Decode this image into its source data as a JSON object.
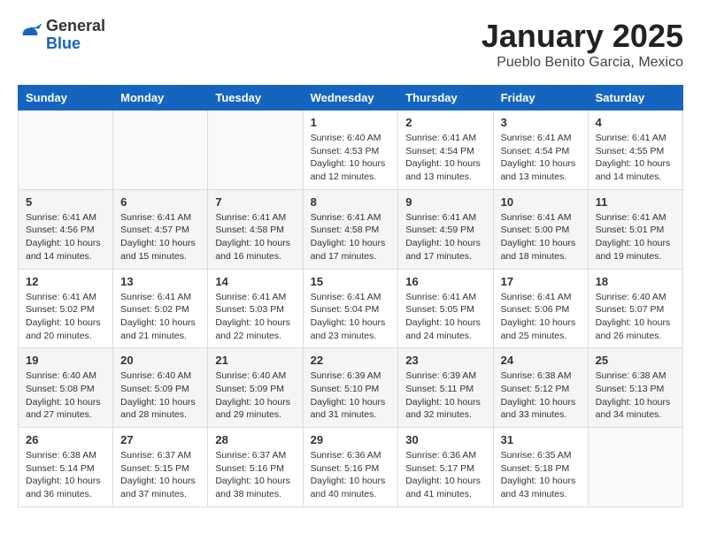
{
  "header": {
    "logo": {
      "general": "General",
      "blue": "Blue"
    },
    "title": "January 2025",
    "location": "Pueblo Benito Garcia, Mexico"
  },
  "calendar": {
    "weekdays": [
      "Sunday",
      "Monday",
      "Tuesday",
      "Wednesday",
      "Thursday",
      "Friday",
      "Saturday"
    ],
    "weeks": [
      [
        {
          "day": "",
          "sunrise": "",
          "sunset": "",
          "daylight": ""
        },
        {
          "day": "",
          "sunrise": "",
          "sunset": "",
          "daylight": ""
        },
        {
          "day": "",
          "sunrise": "",
          "sunset": "",
          "daylight": ""
        },
        {
          "day": "1",
          "sunrise": "Sunrise: 6:40 AM",
          "sunset": "Sunset: 4:53 PM",
          "daylight": "Daylight: 10 hours and 12 minutes."
        },
        {
          "day": "2",
          "sunrise": "Sunrise: 6:41 AM",
          "sunset": "Sunset: 4:54 PM",
          "daylight": "Daylight: 10 hours and 13 minutes."
        },
        {
          "day": "3",
          "sunrise": "Sunrise: 6:41 AM",
          "sunset": "Sunset: 4:54 PM",
          "daylight": "Daylight: 10 hours and 13 minutes."
        },
        {
          "day": "4",
          "sunrise": "Sunrise: 6:41 AM",
          "sunset": "Sunset: 4:55 PM",
          "daylight": "Daylight: 10 hours and 14 minutes."
        }
      ],
      [
        {
          "day": "5",
          "sunrise": "Sunrise: 6:41 AM",
          "sunset": "Sunset: 4:56 PM",
          "daylight": "Daylight: 10 hours and 14 minutes."
        },
        {
          "day": "6",
          "sunrise": "Sunrise: 6:41 AM",
          "sunset": "Sunset: 4:57 PM",
          "daylight": "Daylight: 10 hours and 15 minutes."
        },
        {
          "day": "7",
          "sunrise": "Sunrise: 6:41 AM",
          "sunset": "Sunset: 4:58 PM",
          "daylight": "Daylight: 10 hours and 16 minutes."
        },
        {
          "day": "8",
          "sunrise": "Sunrise: 6:41 AM",
          "sunset": "Sunset: 4:58 PM",
          "daylight": "Daylight: 10 hours and 17 minutes."
        },
        {
          "day": "9",
          "sunrise": "Sunrise: 6:41 AM",
          "sunset": "Sunset: 4:59 PM",
          "daylight": "Daylight: 10 hours and 17 minutes."
        },
        {
          "day": "10",
          "sunrise": "Sunrise: 6:41 AM",
          "sunset": "Sunset: 5:00 PM",
          "daylight": "Daylight: 10 hours and 18 minutes."
        },
        {
          "day": "11",
          "sunrise": "Sunrise: 6:41 AM",
          "sunset": "Sunset: 5:01 PM",
          "daylight": "Daylight: 10 hours and 19 minutes."
        }
      ],
      [
        {
          "day": "12",
          "sunrise": "Sunrise: 6:41 AM",
          "sunset": "Sunset: 5:02 PM",
          "daylight": "Daylight: 10 hours and 20 minutes."
        },
        {
          "day": "13",
          "sunrise": "Sunrise: 6:41 AM",
          "sunset": "Sunset: 5:02 PM",
          "daylight": "Daylight: 10 hours and 21 minutes."
        },
        {
          "day": "14",
          "sunrise": "Sunrise: 6:41 AM",
          "sunset": "Sunset: 5:03 PM",
          "daylight": "Daylight: 10 hours and 22 minutes."
        },
        {
          "day": "15",
          "sunrise": "Sunrise: 6:41 AM",
          "sunset": "Sunset: 5:04 PM",
          "daylight": "Daylight: 10 hours and 23 minutes."
        },
        {
          "day": "16",
          "sunrise": "Sunrise: 6:41 AM",
          "sunset": "Sunset: 5:05 PM",
          "daylight": "Daylight: 10 hours and 24 minutes."
        },
        {
          "day": "17",
          "sunrise": "Sunrise: 6:41 AM",
          "sunset": "Sunset: 5:06 PM",
          "daylight": "Daylight: 10 hours and 25 minutes."
        },
        {
          "day": "18",
          "sunrise": "Sunrise: 6:40 AM",
          "sunset": "Sunset: 5:07 PM",
          "daylight": "Daylight: 10 hours and 26 minutes."
        }
      ],
      [
        {
          "day": "19",
          "sunrise": "Sunrise: 6:40 AM",
          "sunset": "Sunset: 5:08 PM",
          "daylight": "Daylight: 10 hours and 27 minutes."
        },
        {
          "day": "20",
          "sunrise": "Sunrise: 6:40 AM",
          "sunset": "Sunset: 5:09 PM",
          "daylight": "Daylight: 10 hours and 28 minutes."
        },
        {
          "day": "21",
          "sunrise": "Sunrise: 6:40 AM",
          "sunset": "Sunset: 5:09 PM",
          "daylight": "Daylight: 10 hours and 29 minutes."
        },
        {
          "day": "22",
          "sunrise": "Sunrise: 6:39 AM",
          "sunset": "Sunset: 5:10 PM",
          "daylight": "Daylight: 10 hours and 31 minutes."
        },
        {
          "day": "23",
          "sunrise": "Sunrise: 6:39 AM",
          "sunset": "Sunset: 5:11 PM",
          "daylight": "Daylight: 10 hours and 32 minutes."
        },
        {
          "day": "24",
          "sunrise": "Sunrise: 6:38 AM",
          "sunset": "Sunset: 5:12 PM",
          "daylight": "Daylight: 10 hours and 33 minutes."
        },
        {
          "day": "25",
          "sunrise": "Sunrise: 6:38 AM",
          "sunset": "Sunset: 5:13 PM",
          "daylight": "Daylight: 10 hours and 34 minutes."
        }
      ],
      [
        {
          "day": "26",
          "sunrise": "Sunrise: 6:38 AM",
          "sunset": "Sunset: 5:14 PM",
          "daylight": "Daylight: 10 hours and 36 minutes."
        },
        {
          "day": "27",
          "sunrise": "Sunrise: 6:37 AM",
          "sunset": "Sunset: 5:15 PM",
          "daylight": "Daylight: 10 hours and 37 minutes."
        },
        {
          "day": "28",
          "sunrise": "Sunrise: 6:37 AM",
          "sunset": "Sunset: 5:16 PM",
          "daylight": "Daylight: 10 hours and 38 minutes."
        },
        {
          "day": "29",
          "sunrise": "Sunrise: 6:36 AM",
          "sunset": "Sunset: 5:16 PM",
          "daylight": "Daylight: 10 hours and 40 minutes."
        },
        {
          "day": "30",
          "sunrise": "Sunrise: 6:36 AM",
          "sunset": "Sunset: 5:17 PM",
          "daylight": "Daylight: 10 hours and 41 minutes."
        },
        {
          "day": "31",
          "sunrise": "Sunrise: 6:35 AM",
          "sunset": "Sunset: 5:18 PM",
          "daylight": "Daylight: 10 hours and 43 minutes."
        },
        {
          "day": "",
          "sunrise": "",
          "sunset": "",
          "daylight": ""
        }
      ]
    ]
  }
}
